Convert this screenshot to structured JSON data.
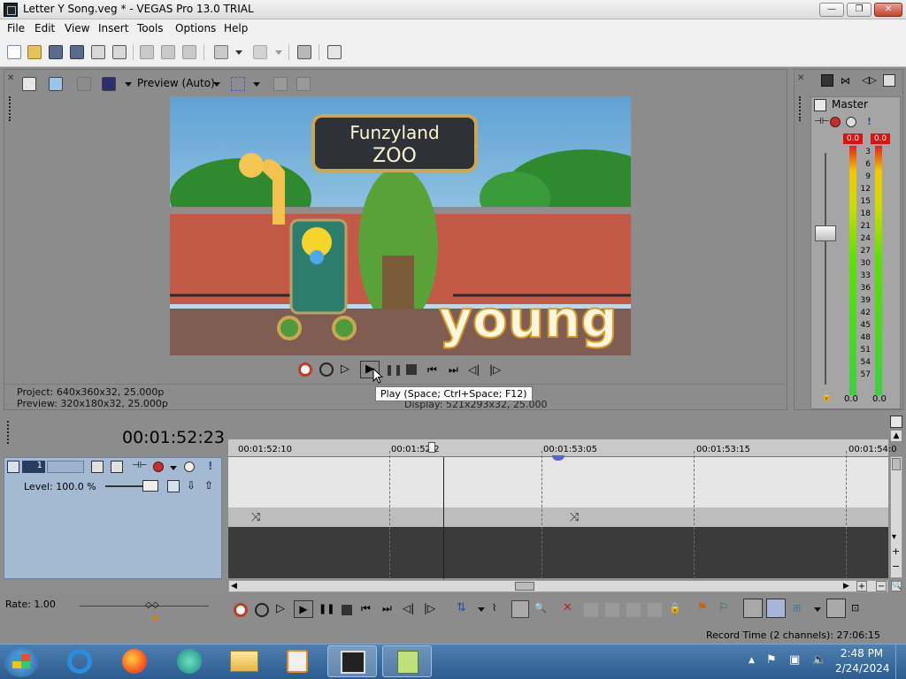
{
  "window": {
    "title": "Letter Y Song.veg * - VEGAS Pro 13.0 TRIAL",
    "min": "—",
    "max": "❐",
    "close": "✕"
  },
  "menu": [
    "File",
    "Edit",
    "View",
    "Insert",
    "Tools",
    "Options",
    "Help"
  ],
  "preview": {
    "mode_label": "Preview (Auto)",
    "scene": {
      "sign_line1": "Funzyland",
      "sign_line2": "ZOO",
      "caption": "young"
    },
    "project_info": "Project:   640x360x32, 25.000p",
    "preview_info": "Preview:  320x180x32, 25.000p",
    "display_info": "Display:    521x293x32, 25.000",
    "tooltip": "Play (Space; Ctrl+Space; F12)"
  },
  "master": {
    "label": "Master",
    "peak_left": "0.0",
    "peak_right": "0.0",
    "scale": [
      "3",
      "6",
      "9",
      "12",
      "15",
      "18",
      "21",
      "24",
      "27",
      "30",
      "33",
      "36",
      "39",
      "42",
      "45",
      "48",
      "51",
      "54",
      "57"
    ],
    "bottom_left": "0.0",
    "bottom_right": "0.0"
  },
  "timeline": {
    "time": "00:01:52:23",
    "ruler": [
      "00:01:52:10",
      "00:01:52:2",
      "00:01:53:05",
      "00:01:53:15",
      "00:01:54:0"
    ],
    "track": {
      "number": "1",
      "level": "Level: 100.0 %"
    }
  },
  "rate": "Rate: 1.00",
  "status": {
    "record_time": "Record Time (2 channels): 27:06:15"
  },
  "taskbar": {
    "time": "2:48 PM",
    "date": "2/24/2024"
  },
  "colors": {
    "timeline_track": "#a4b9d2",
    "panel": "#8c8c8c",
    "meter_green": "#3ed040",
    "peak_red": "#e01010",
    "taskbar": "#2c5c8f"
  }
}
